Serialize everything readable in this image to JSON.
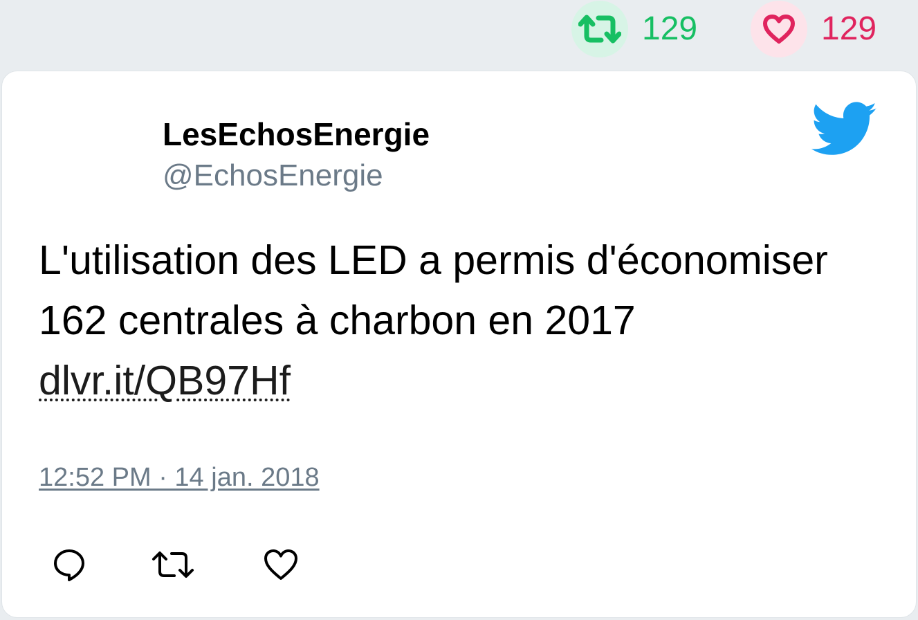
{
  "stats": {
    "retweet_count": "129",
    "like_count": "129",
    "retweet_icon": "retweet-icon",
    "like_icon": "heart-icon"
  },
  "tweet": {
    "display_name": "LesEchosEnergie",
    "handle": "@EchosEnergie",
    "text": "L'utilisation des LED a permis d'économiser 162 centrales à charbon en 2017 ",
    "link_text": "dlvr.it/QB97Hf",
    "timestamp": "12:52 PM · 14 jan. 2018",
    "brand_icon": "twitter-bird-icon"
  },
  "actions": [
    {
      "icon": "reply-icon"
    },
    {
      "icon": "retweet-icon"
    },
    {
      "icon": "heart-icon"
    }
  ],
  "colors": {
    "retweet_green": "#17bf63",
    "like_red": "#e0245e",
    "twitter_blue": "#1da1f2",
    "muted_gray": "#6b7a88",
    "page_background": "#e9edf0"
  }
}
